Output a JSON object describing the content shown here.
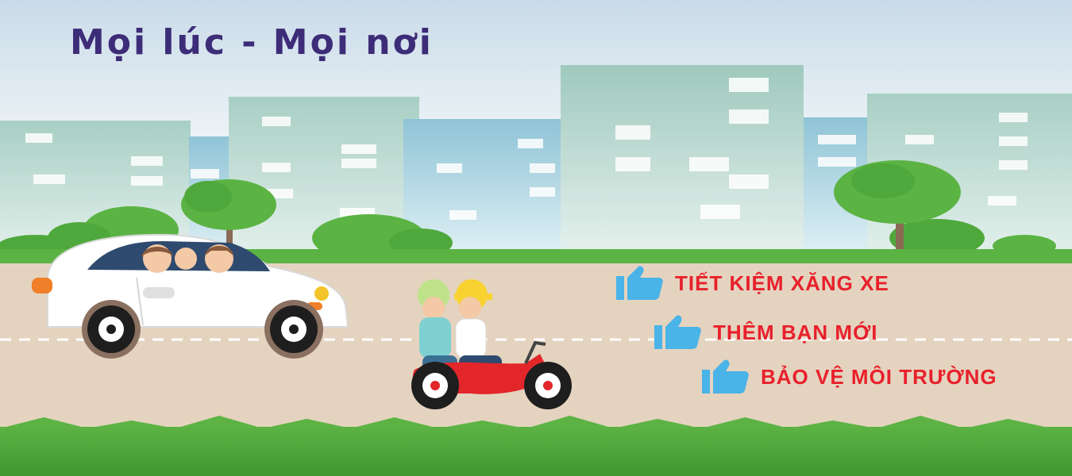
{
  "banner": {
    "title": "Mọi lúc - Mọi nơi",
    "benefits": [
      {
        "label": "TIẾT KIỆM XĂNG XE",
        "icon": "thumbs-up-icon"
      },
      {
        "label": "THÊM BẠN MỚI",
        "icon": "thumbs-up-icon"
      },
      {
        "label": "BẢO VỆ MÔI TRƯỜNG",
        "icon": "thumbs-up-icon"
      }
    ]
  },
  "colors": {
    "title": "#3d2c78",
    "benefit_text": "#e8202b",
    "thumb_icon": "#4ab3e8",
    "road": "#e4d3bf",
    "grass": "#4fa83b",
    "sky_top": "#cfdde8"
  }
}
